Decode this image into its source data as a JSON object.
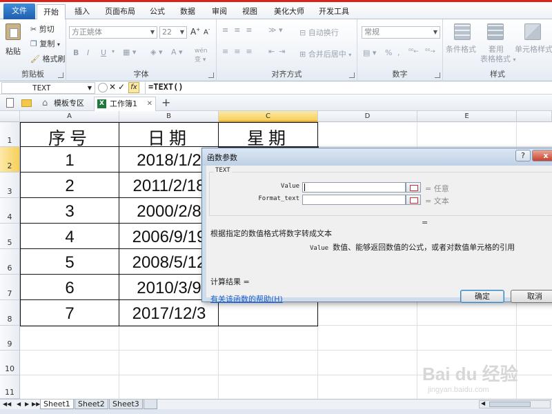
{
  "ribbon_tabs": [
    "文件",
    "开始",
    "插入",
    "页面布局",
    "公式",
    "数据",
    "审阅",
    "视图",
    "美化大师",
    "开发工具"
  ],
  "clipboard": {
    "paste": "粘贴",
    "cut": "剪切",
    "copy": "复制",
    "format_painter": "格式刷",
    "caption": "剪贴板"
  },
  "font": {
    "name": "方正姚体",
    "size": "22",
    "bold": "B",
    "italic": "I",
    "underline": "U",
    "caption": "字体",
    "wen": "wén"
  },
  "alignment": {
    "wrap_text": "自动换行",
    "merge_center": "合并后居中",
    "caption": "对齐方式"
  },
  "number": {
    "format": "常规",
    "percent": "%",
    "comma": ",",
    "caption": "数字"
  },
  "styles": {
    "conditional": "条件格式",
    "table_format_1": "套用",
    "table_format_2": "表格格式",
    "cell_styles": "单元格样式",
    "caption": "样式"
  },
  "formula_bar": {
    "name_box": "TEXT",
    "formula": "=TEXT()"
  },
  "doc_tabs": {
    "template": "模板专区",
    "workbook": "工作簿1"
  },
  "columns": [
    "A",
    "B",
    "C",
    "D",
    "E"
  ],
  "rows": [
    "1",
    "2",
    "3",
    "4",
    "5",
    "6",
    "7",
    "8",
    "9",
    "10",
    "11"
  ],
  "table": {
    "headers": [
      "序号",
      "日期",
      "星期"
    ],
    "data": [
      [
        "1",
        "2018/1/2"
      ],
      [
        "2",
        "2011/2/18"
      ],
      [
        "3",
        "2000/2/8"
      ],
      [
        "4",
        "2006/9/19"
      ],
      [
        "5",
        "2008/5/12"
      ],
      [
        "6",
        "2010/3/9"
      ],
      [
        "7",
        "2017/12/3"
      ]
    ]
  },
  "sheets": [
    "Sheet1",
    "Sheet2",
    "Sheet3"
  ],
  "dialog": {
    "title": "函数参数",
    "help_q": "?",
    "close": "x",
    "function_name": "TEXT",
    "args": [
      {
        "label": "Value",
        "value": "",
        "result": "任意"
      },
      {
        "label": "Format_text",
        "value": "",
        "result": "文本"
      }
    ],
    "equals": "=",
    "description": "根据指定的数值格式将数字转成文本",
    "arg_help_name": "Value",
    "arg_help_text": "数值、能够返回数值的公式，或者对数值单元格的引用",
    "result_label": "计算结果 =",
    "help_link": "有关该函数的帮助(H)",
    "ok": "确定",
    "cancel": "取消"
  },
  "watermark": {
    "brand": "Bai du 经验",
    "url": "jingyan.baidu.com"
  },
  "colors": {
    "file_tab": "#2f74c4",
    "accent_red": "#d9241b",
    "selection": "#f7cf58",
    "dialog_frame": "#cfdcec"
  }
}
